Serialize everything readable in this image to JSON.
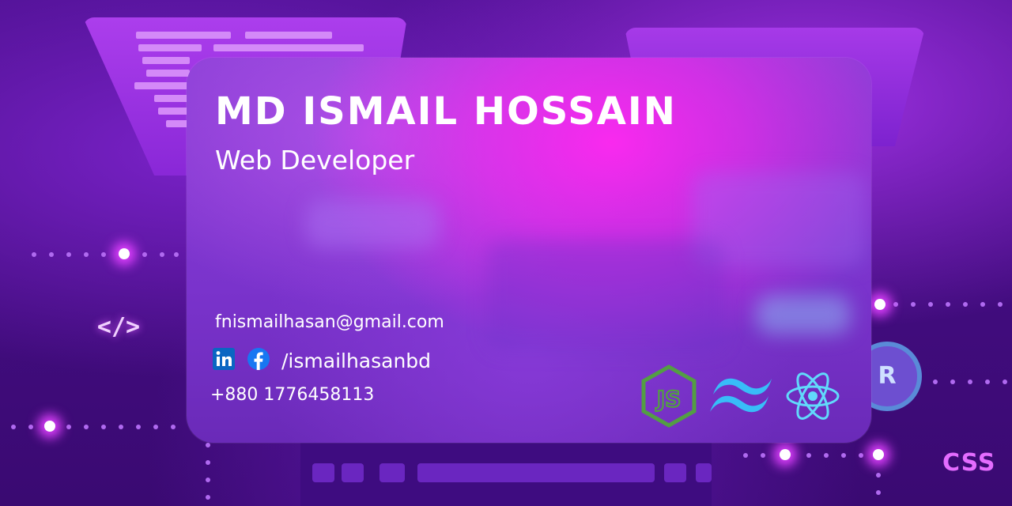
{
  "card": {
    "name": "MD ISMAIL HOSSAIN",
    "role": "Web Developer",
    "email": "fnismailhasan@gmail.com",
    "social_handle": "/ismailhasanbd",
    "phone": "+880 1776458113",
    "social_icons": [
      "linkedin-icon",
      "facebook-icon"
    ],
    "tech_icons": [
      "nodejs-icon",
      "tailwind-icon",
      "react-icon"
    ]
  },
  "background": {
    "code_tag": "</>",
    "badge_letter": "R",
    "css_label": "CSS"
  },
  "colors": {
    "background": "#4a0d86",
    "card_pink": "#ff28f0",
    "nodejs_green": "#539e43",
    "tailwind_blue": "#38bdf8",
    "react_blue": "#61dafb",
    "linkedin_blue": "#0a66c2",
    "facebook_blue": "#1877f2"
  }
}
